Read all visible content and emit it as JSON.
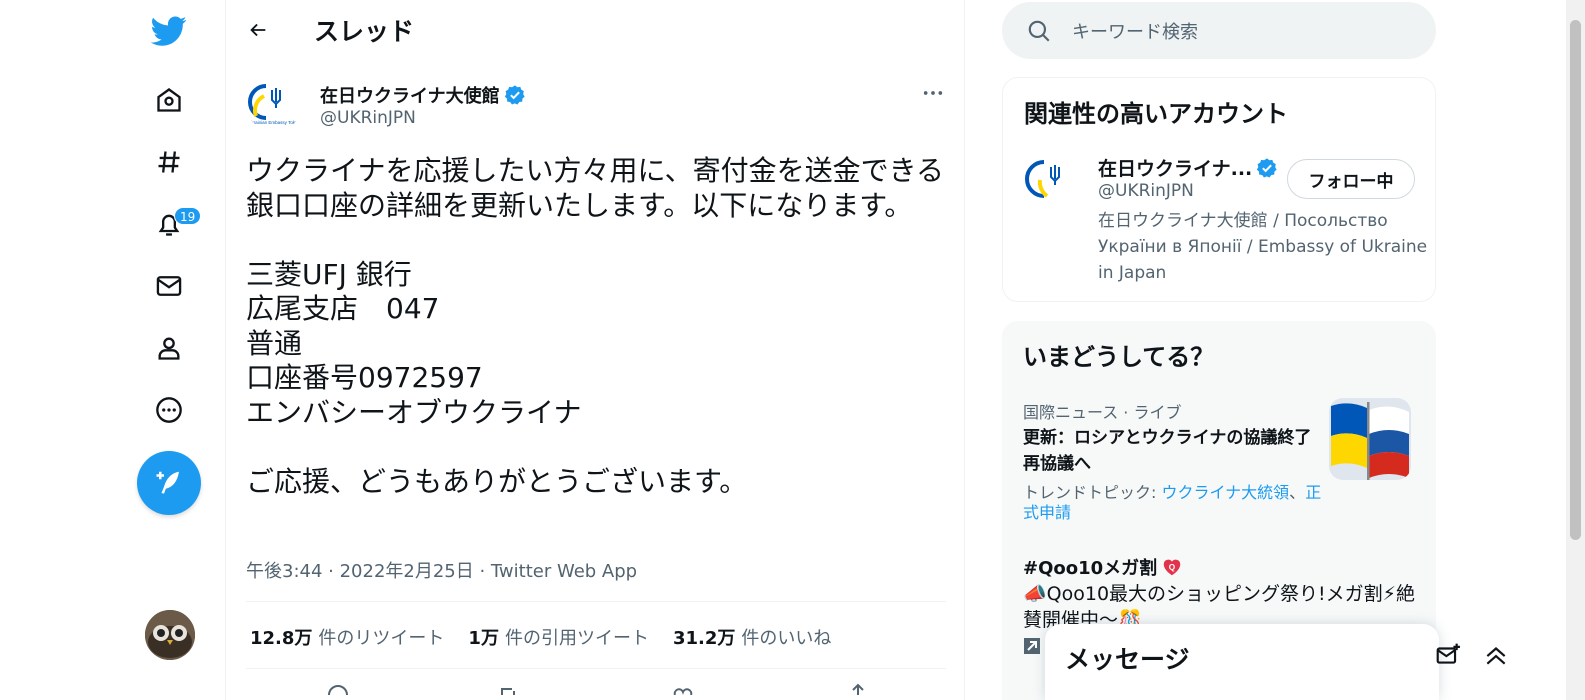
{
  "nav": {
    "notifications_badge": "19"
  },
  "header": {
    "title": "スレッド"
  },
  "tweet": {
    "author_name": "在日ウクライナ大使館",
    "author_handle": "@UKRinJPN",
    "avatar_caption": "Ukrainian Embassy Tokyo",
    "text": "ウクライナを応援したい方々用に、寄付金を送金できる銀口口座の詳細を更新いたします。以下になります。\n\n三菱UFJ 銀行\n広尾支店　047\n普通\n口座番号0972597\nエンバシーオブウクライナ\n\nご応援、どうもありがとうございます。",
    "meta": "午後3:44 · 2022年2月25日 · Twitter Web App",
    "retweets_count": "12.8万",
    "retweets_label": "件のリツイート",
    "quotes_count": "1万",
    "quotes_label": "件の引用ツイート",
    "likes_count": "31.2万",
    "likes_label": "件のいいね"
  },
  "search": {
    "placeholder": "キーワード検索"
  },
  "related": {
    "title": "関連性の高いアカウント",
    "name": "在日ウクライナ...",
    "handle": "@UKRinJPN",
    "bio": "在日ウクライナ大使館 / Посольство України в Японії / Embassy of Ukraine in Japan",
    "follow_label": "フォロー中"
  },
  "trends": {
    "title": "いまどうしてる？",
    "items": [
      {
        "category": "国際ニュース · ライブ",
        "headline": "更新：ロシアとウクライナの協議終了 再協議へ",
        "sub_prefix": "トレンドトピック: ",
        "link1": "ウクライナ大統領",
        "sep": "、",
        "link2": "正式申請"
      },
      {
        "headline": "#Qoo10メガ割",
        "description": "📣Qoo10最大のショッピング祭り!メガ割⚡絶賛開催中～🎊"
      }
    ]
  },
  "messages": {
    "title": "メッセージ"
  },
  "colors": {
    "accent": "#1d9bf0",
    "text_primary": "#0f1419",
    "text_secondary": "#536471",
    "ukraine_blue": "#0057b7",
    "ukraine_yellow": "#ffd700"
  }
}
